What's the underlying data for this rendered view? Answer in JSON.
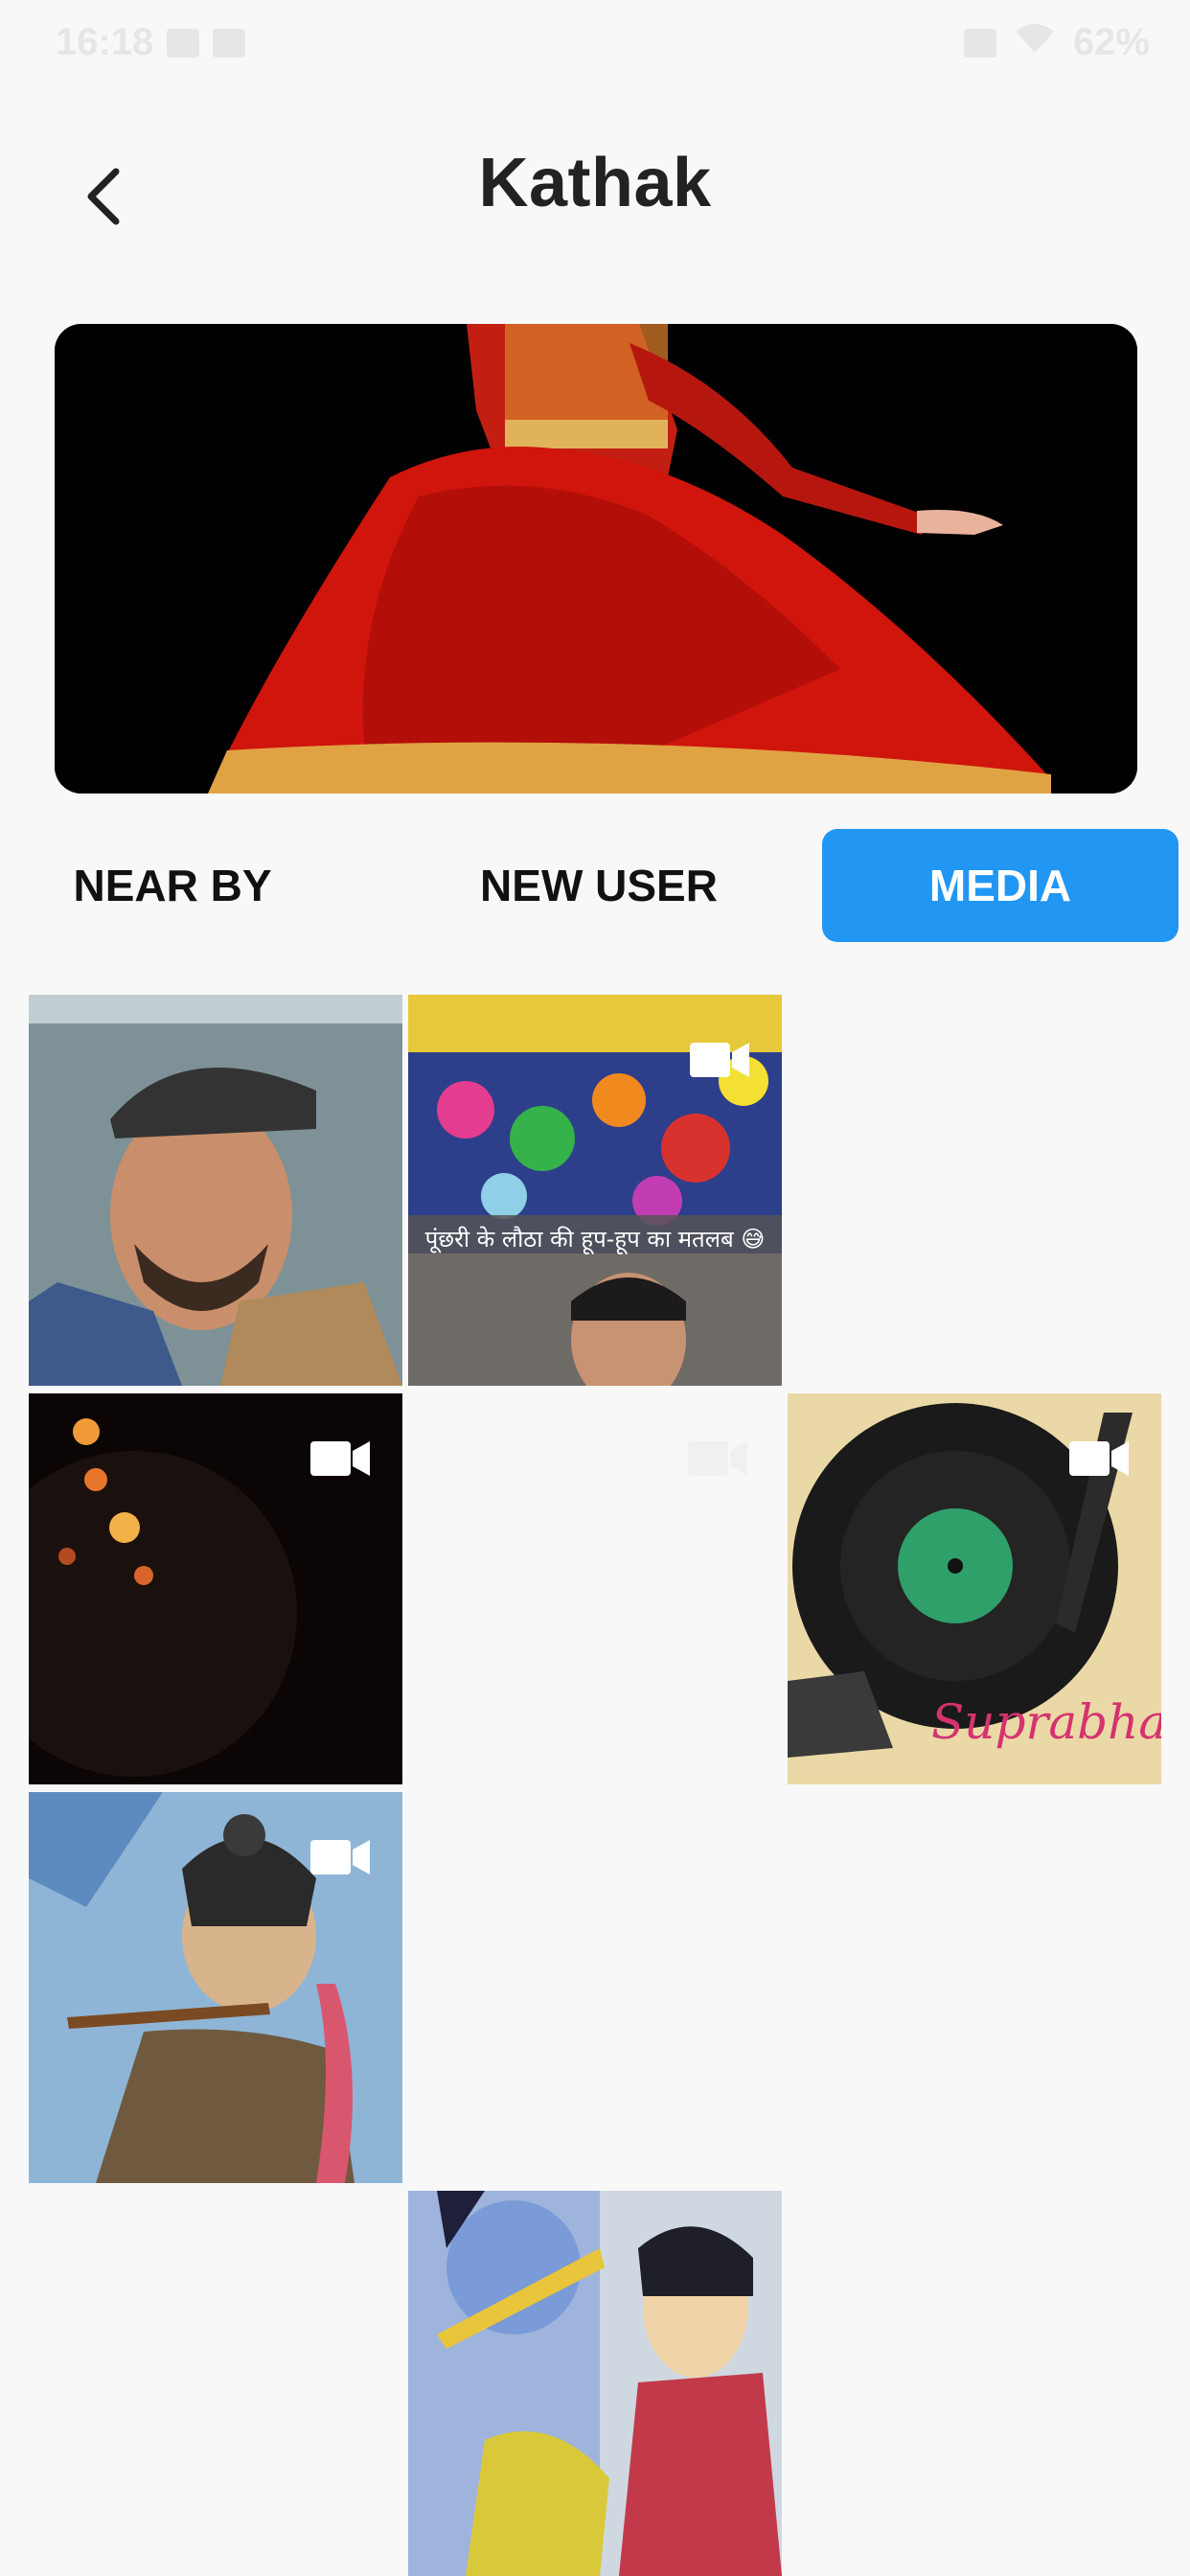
{
  "status_bar": {
    "time": "16:18",
    "battery": "62%"
  },
  "header": {
    "title": "Kathak"
  },
  "tabs": [
    {
      "label": "NEAR BY",
      "active": false
    },
    {
      "label": "NEW USER",
      "active": false
    },
    {
      "label": "MEDIA",
      "active": true
    }
  ],
  "accent_color": "#2196f3",
  "media": [
    {
      "type": "photo"
    },
    {
      "type": "video",
      "caption": "पूंछरी के लौठा की हूप-हूप का मतलब 😅"
    },
    {
      "type": "video"
    },
    {
      "type": "video"
    },
    {
      "type": "video",
      "watermark": "Suprabhat"
    },
    {
      "type": "video"
    },
    {
      "type": "photo"
    }
  ],
  "icons": [
    "back-arrow-icon",
    "video-camera-icon"
  ]
}
